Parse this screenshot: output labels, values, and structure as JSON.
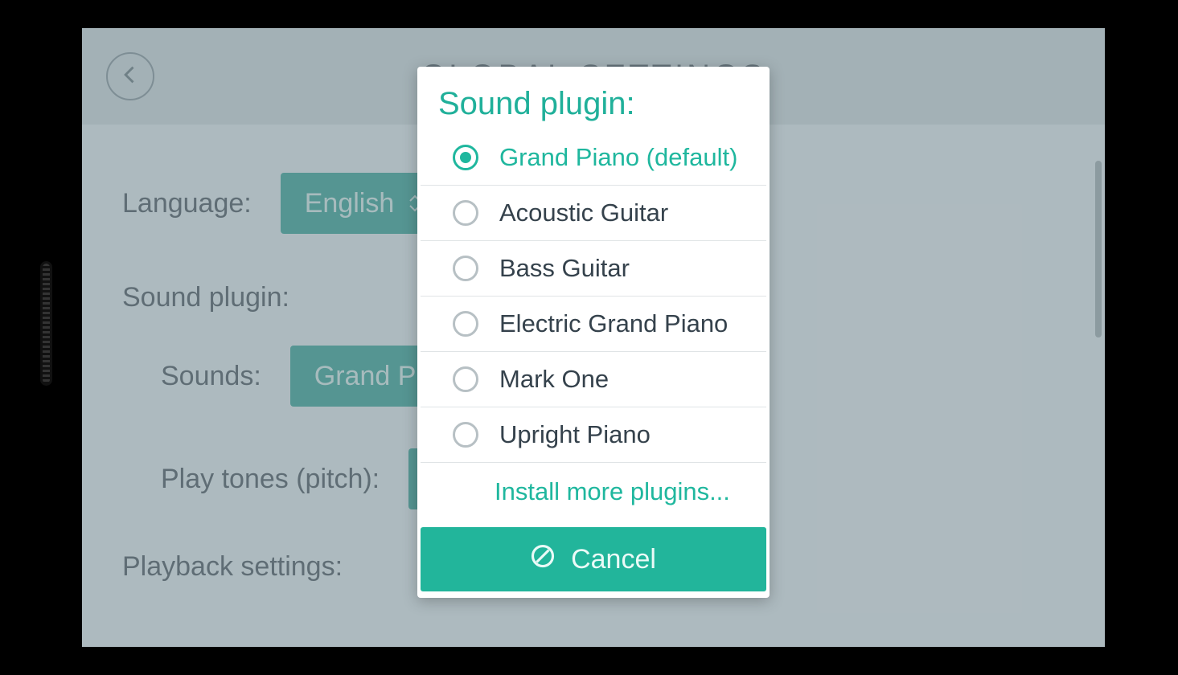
{
  "header": {
    "title": "GLOBAL SETTINGS"
  },
  "settings": {
    "language_label": "Language:",
    "language_value": "English",
    "sound_plugin_section": "Sound plugin:",
    "sounds_label": "Sounds:",
    "sounds_value": "Grand Piano",
    "play_tones_label": "Play tones (pitch):",
    "playback_section": "Playback settings:"
  },
  "modal": {
    "title": "Sound plugin:",
    "options": [
      {
        "label": "Grand Piano (default)",
        "selected": true
      },
      {
        "label": "Acoustic Guitar",
        "selected": false
      },
      {
        "label": "Bass Guitar",
        "selected": false
      },
      {
        "label": "Electric Grand Piano",
        "selected": false
      },
      {
        "label": "Mark One",
        "selected": false
      },
      {
        "label": "Upright Piano",
        "selected": false
      }
    ],
    "install_more": "Install more plugins...",
    "cancel": "Cancel"
  },
  "colors": {
    "accent": "#20b09a",
    "button": "#1f9a8d",
    "text": "#36424c"
  }
}
